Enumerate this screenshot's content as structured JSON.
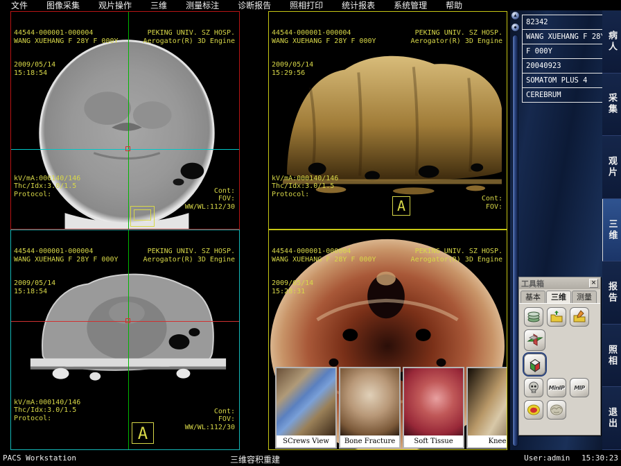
{
  "menu": {
    "items": [
      "文件",
      "图像采集",
      "观片操作",
      "三维",
      "测量标注",
      "诊断报告",
      "照相打印",
      "统计报表",
      "系统管理",
      "帮助"
    ]
  },
  "quads": {
    "q1": {
      "id": "44544-000001-000004",
      "patient": "WANG XUEHANG F 28Y F 000Y",
      "date": "2009/05/14",
      "time": "15:18:54",
      "hospital": "PEKING UNIV. SZ HOSP.",
      "engine": "Aerogator(R) 3D Engine",
      "kvma": "kV/mA:000140/146",
      "thc": "Thc/Idx:3.0/1.5",
      "protocol": "Protocol:",
      "cont": "Cont:",
      "fov": "FOV:",
      "wwwl": "WW/WL:112/30"
    },
    "q2": {
      "id": "44544-000001-000004",
      "patient": "WANG XUEHANG F 28Y F 000Y",
      "date": "2009/05/14",
      "time": "15:29:56",
      "hospital": "PEKING UNIV. SZ HOSP.",
      "engine": "Aerogator(R) 3D Engine",
      "kvma": "kV/mA:000140/146",
      "thc": "Thc/Idx:3.0/1.5",
      "protocol": "Protocol:",
      "cont": "Cont:",
      "fov": "FOV:",
      "marker": "A"
    },
    "q3": {
      "id": "44544-000001-000004",
      "patient": "WANG XUEHANG F 28Y F 000Y",
      "date": "2009/05/14",
      "time": "15:18:54",
      "hospital": "PEKING UNIV. SZ HOSP.",
      "engine": "Aerogator(R) 3D Engine",
      "kvma": "kV/mA:000140/146",
      "thc": "Thc/Idx:3.0/1.5",
      "protocol": "Protocol:",
      "cont": "Cont:",
      "fov": "FOV:",
      "wwwl": "WW/WL:112/30",
      "marker": "A"
    },
    "q4": {
      "id": "44544-000001-000004",
      "patient": "WANG XUEHANG F 28Y F 000Y",
      "date": "2009/05/14",
      "time": "15:28:31",
      "hospital": "PEKING UNIV. SZ HOSP.",
      "engine": "Aerogator(R) 3D Engine"
    }
  },
  "thumbnails": [
    {
      "label": "SCrews View"
    },
    {
      "label": "Bone Fracture"
    },
    {
      "label": "Soft Tissue"
    },
    {
      "label": "Knee"
    }
  ],
  "sidebar": {
    "patient_fields": [
      "82342",
      "WANG XUEHANG F 28Y",
      "F 000Y",
      "20040923",
      "SOMATOM PLUS 4",
      "CEREBRUM"
    ],
    "tabs": [
      "病人",
      "采集",
      "观片",
      "三维",
      "报告",
      "照相",
      "退出"
    ],
    "active_tab": "三维"
  },
  "toolbox": {
    "title": "工具箱",
    "close_glyph": "×",
    "tabs": [
      "基本",
      "三维",
      "测量"
    ],
    "active_tab": "三维",
    "minip_label": "MinIP",
    "mip_label": "MIP"
  },
  "slider": {
    "up_glyph": "▲",
    "dot_glyph": "●"
  },
  "statusbar": {
    "app": "PACS Workstation",
    "mode": "三维容积重建",
    "user": "User:admin",
    "time": "15:30:23"
  },
  "colors": {
    "overlay_text": "#d8d848",
    "q1_border": "#b81414",
    "q2_border": "#c8c814",
    "q3_border": "#14b8b8",
    "q4_border": "#c8c814",
    "crosshair_green": "#00b400",
    "crosshair_cyan": "#00c8c8",
    "crosshair_red": "#d03030"
  }
}
